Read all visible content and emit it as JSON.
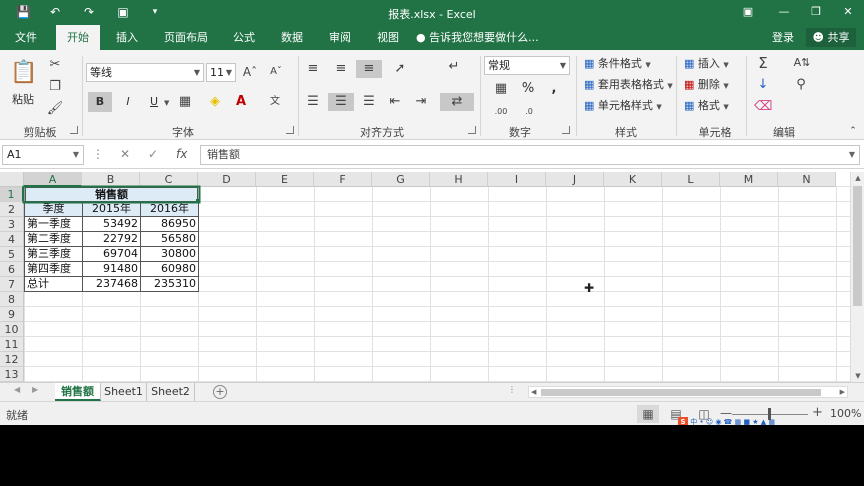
{
  "window": {
    "title": "报表.xlsx - Excel"
  },
  "ribbon_tabs": [
    "文件",
    "开始",
    "插入",
    "页面布局",
    "公式",
    "数据",
    "审阅",
    "视图"
  ],
  "tell_me": "告诉我您想要做什么...",
  "login": "登录",
  "share": "共享",
  "clipboard": {
    "paste": "粘贴",
    "label": "剪贴板"
  },
  "font": {
    "name": "等线",
    "size": "11",
    "bold": "B",
    "italic": "I",
    "underline": "U",
    "label": "字体"
  },
  "alignment": {
    "label": "对齐方式"
  },
  "number": {
    "format": "常规",
    "percent": "%",
    "comma": ",",
    "label": "数字"
  },
  "styles": {
    "conditional": "条件格式",
    "as_table": "套用表格格式",
    "cell_styles": "单元格样式",
    "label": "样式"
  },
  "cells": {
    "insert": "插入",
    "delete": "删除",
    "format": "格式",
    "label": "单元格"
  },
  "editing": {
    "label": "编辑"
  },
  "formula_bar": {
    "name_box": "A1",
    "content": "销售额"
  },
  "columns": [
    "A",
    "B",
    "C",
    "D",
    "E",
    "F",
    "G",
    "H",
    "I",
    "J",
    "K",
    "L",
    "M",
    "N"
  ],
  "rows": [
    "1",
    "2",
    "3",
    "4",
    "5",
    "6",
    "7",
    "8",
    "9",
    "10",
    "11",
    "12",
    "13"
  ],
  "table": {
    "title": "销售额",
    "headers": [
      "季度",
      "2015年",
      "2016年"
    ],
    "rows": [
      [
        "第一季度",
        "53492",
        "86950"
      ],
      [
        "第二季度",
        "22792",
        "56580"
      ],
      [
        "第三季度",
        "69704",
        "30800"
      ],
      [
        "第四季度",
        "91480",
        "60980"
      ],
      [
        "总计",
        "237468",
        "235310"
      ]
    ]
  },
  "sheets": [
    "销售额",
    "Sheet1",
    "Sheet2"
  ],
  "status": {
    "text": "就绪",
    "zoom": "100%"
  },
  "colors": {
    "brand": "#217346",
    "header_fill": "#ddebf7"
  }
}
